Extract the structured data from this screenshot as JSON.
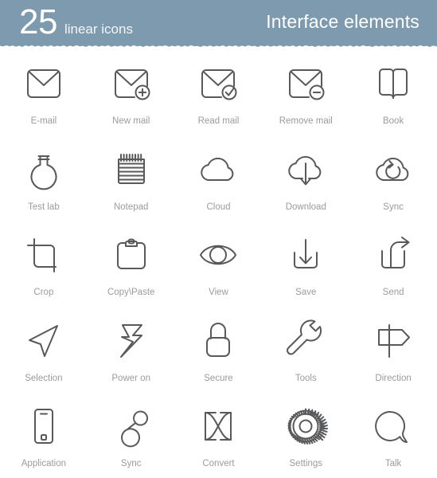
{
  "header": {
    "count": "25",
    "count_label": "linear icons",
    "title": "Interface elements",
    "background_color": "#7e9aae",
    "text_color": "#ffffff"
  },
  "style": {
    "icon_stroke_color": "#58595b",
    "caption_color": "#9b9b9b",
    "page_background": "#ffffff"
  },
  "grid": {
    "columns": 5,
    "rows": 5,
    "total": 25
  },
  "icons": [
    {
      "label": "E-mail",
      "icon": "envelope-icon"
    },
    {
      "label": "New mail",
      "icon": "envelope-plus-icon"
    },
    {
      "label": "Read mail",
      "icon": "envelope-check-icon"
    },
    {
      "label": "Remove mail",
      "icon": "envelope-minus-icon"
    },
    {
      "label": "Book",
      "icon": "open-book-icon"
    },
    {
      "label": "Test lab",
      "icon": "flask-icon"
    },
    {
      "label": "Notepad",
      "icon": "notepad-icon"
    },
    {
      "label": "Cloud",
      "icon": "cloud-icon"
    },
    {
      "label": "Download",
      "icon": "cloud-download-icon"
    },
    {
      "label": "Sync",
      "icon": "cloud-sync-icon"
    },
    {
      "label": "Crop",
      "icon": "crop-icon"
    },
    {
      "label": "Copy\\Paste",
      "icon": "clipboard-icon"
    },
    {
      "label": "View",
      "icon": "eye-icon"
    },
    {
      "label": "Save",
      "icon": "save-tray-arrow-icon"
    },
    {
      "label": "Send",
      "icon": "send-tray-arrow-icon"
    },
    {
      "label": "Selection",
      "icon": "cursor-arrow-icon"
    },
    {
      "label": "Power on",
      "icon": "lightning-bolt-icon"
    },
    {
      "label": "Secure",
      "icon": "padlock-icon"
    },
    {
      "label": "Tools",
      "icon": "wrench-icon"
    },
    {
      "label": "Direction",
      "icon": "signpost-icon"
    },
    {
      "label": "Application",
      "icon": "smartphone-icon"
    },
    {
      "label": "Sync",
      "icon": "infinity-icon"
    },
    {
      "label": "Convert",
      "icon": "bowtie-convert-icon"
    },
    {
      "label": "Settings",
      "icon": "gear-icon"
    },
    {
      "label": "Talk",
      "icon": "speech-bubble-icon"
    }
  ]
}
